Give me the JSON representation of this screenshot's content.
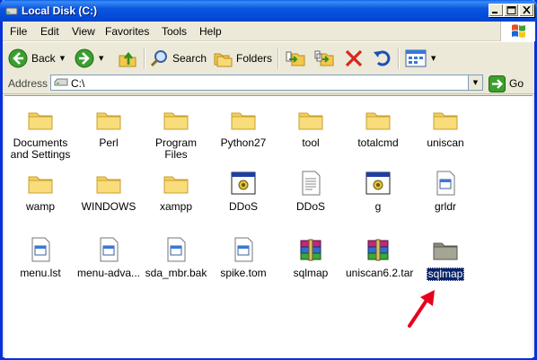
{
  "window": {
    "title": "Local Disk (C:)"
  },
  "menu": {
    "items": [
      "File",
      "Edit",
      "View",
      "Favorites",
      "Tools",
      "Help"
    ]
  },
  "toolbar": {
    "back_label": "Back",
    "search_label": "Search",
    "folders_label": "Folders"
  },
  "address": {
    "label": "Address",
    "value": "C:\\",
    "go_label": "Go"
  },
  "files": [
    {
      "name": "Documents and Settings",
      "type": "folder"
    },
    {
      "name": "Perl",
      "type": "folder"
    },
    {
      "name": "Program Files",
      "type": "folder"
    },
    {
      "name": "Python27",
      "type": "folder"
    },
    {
      "name": "tool",
      "type": "folder"
    },
    {
      "name": "totalcmd",
      "type": "folder"
    },
    {
      "name": "uniscan",
      "type": "folder"
    },
    {
      "name": "wamp",
      "type": "folder"
    },
    {
      "name": "WINDOWS",
      "type": "folder"
    },
    {
      "name": "xampp",
      "type": "folder"
    },
    {
      "name": "DDoS",
      "type": "exe"
    },
    {
      "name": "DDoS",
      "type": "text"
    },
    {
      "name": "g",
      "type": "exe"
    },
    {
      "name": "grldr",
      "type": "file"
    },
    {
      "name": "menu.lst",
      "type": "file"
    },
    {
      "name": "menu-adva...",
      "type": "file"
    },
    {
      "name": "sda_mbr.bak",
      "type": "file"
    },
    {
      "name": "spike.tom",
      "type": "file"
    },
    {
      "name": "sqlmap",
      "type": "archive"
    },
    {
      "name": "uniscan6.2.tar",
      "type": "archive"
    },
    {
      "name": "sqlmap",
      "type": "folder-gray",
      "selected": true
    }
  ],
  "colors": {
    "title_bar": "#0a56e2",
    "selection": "#0a246a",
    "annotation_arrow": "#e8001c"
  }
}
